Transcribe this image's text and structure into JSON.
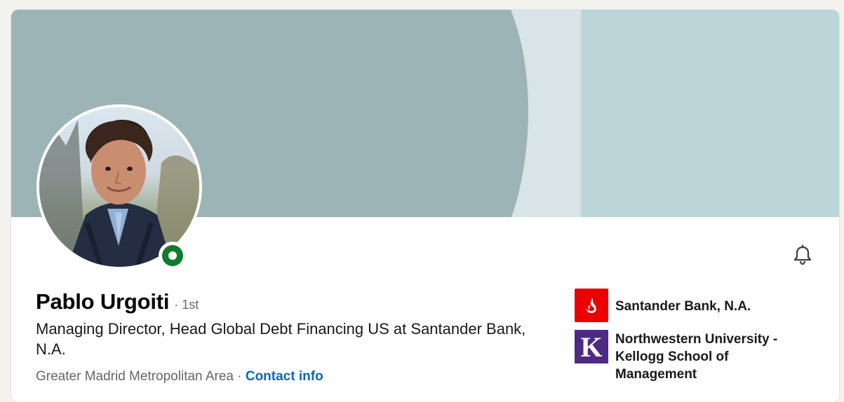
{
  "profile": {
    "name": "Pablo Urgoiti",
    "degree": "· 1st",
    "headline": "Managing Director, Head Global Debt Financing US at Santander Bank, N.A.",
    "location": "Greater Madrid Metropolitan Area",
    "separator": " · ",
    "contact_info_label": "Contact info",
    "status": "online"
  },
  "right_panel": {
    "items": [
      {
        "label": "Santander Bank, N.A.",
        "logo": "santander-logo-icon"
      },
      {
        "label": "Northwestern University -\nKellogg School of\nManagement",
        "logo": "northwestern-k-logo-icon"
      }
    ]
  },
  "icons": {
    "notification": "bell-icon",
    "presence": "online-status-icon"
  },
  "colors": {
    "page_background": "#f3f2ef",
    "banner_dark": "#9cb4b6",
    "banner_light": "#d8e4e8",
    "banner_right": "#bcd5d8",
    "link": "#0a66c2",
    "online": "#0f7b2c",
    "santander_red": "#ec0000",
    "northwestern_purple": "#4e2a84"
  }
}
